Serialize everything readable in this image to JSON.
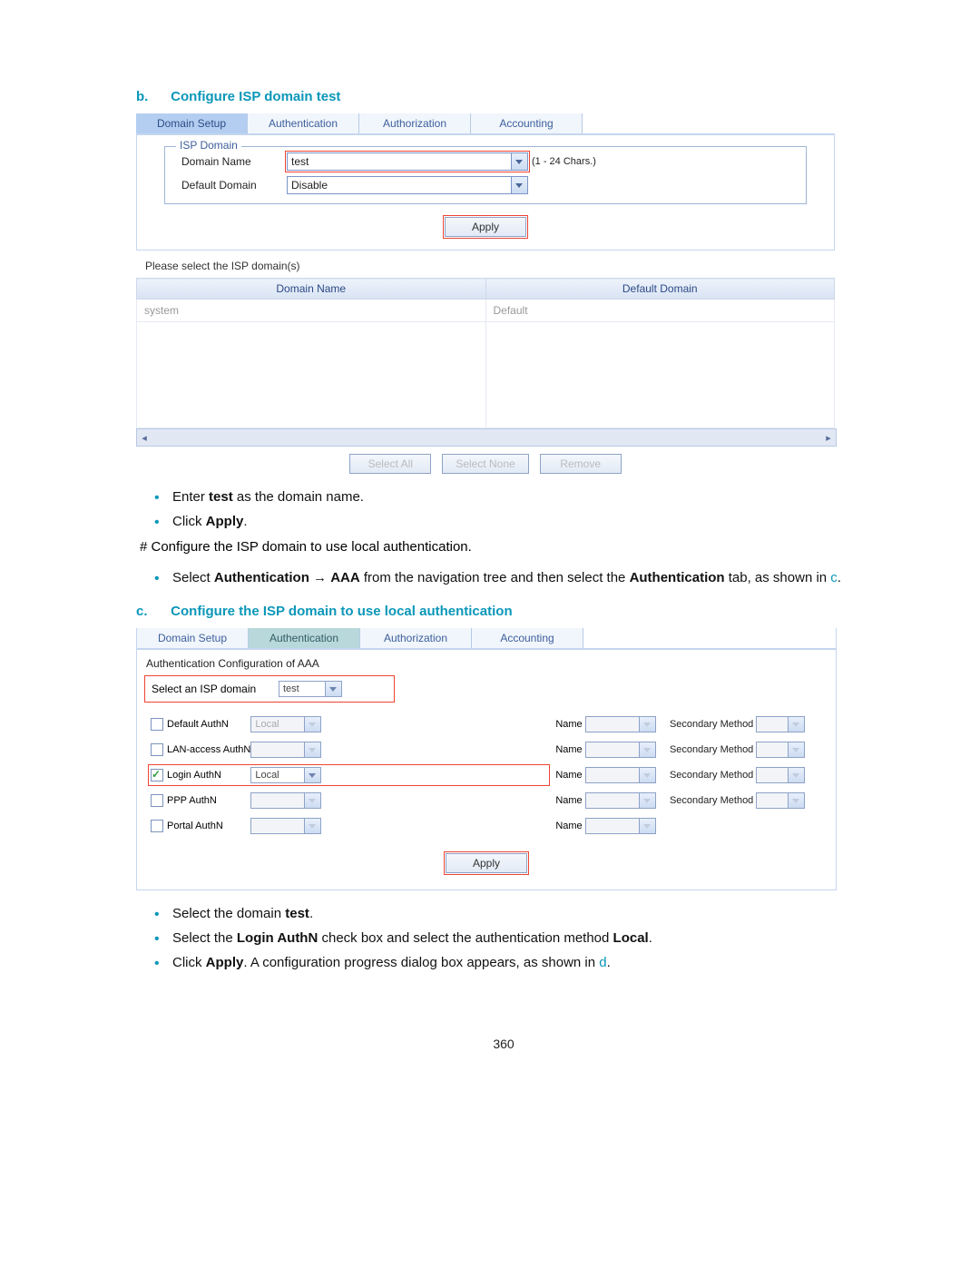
{
  "section_b": {
    "marker": "b.",
    "title": "Configure ISP domain test"
  },
  "panelA": {
    "tabs": [
      "Domain Setup",
      "Authentication",
      "Authorization",
      "Accounting"
    ],
    "active_tab_index": 0,
    "fieldset_legend": "ISP Domain",
    "domain_name_label": "Domain Name",
    "domain_name_value": "test",
    "chars_hint": "(1 - 24 Chars.)",
    "default_domain_label": "Default Domain",
    "default_domain_value": "Disable",
    "apply_label": "Apply",
    "please_select": "Please select the ISP domain(s)",
    "table_headers": [
      "Domain Name",
      "Default Domain"
    ],
    "table_rows": [
      {
        "domain": "system",
        "default": "Default"
      }
    ],
    "buttons": [
      "Select All",
      "Select None",
      "Remove"
    ]
  },
  "instructions1": {
    "items": [
      {
        "pre": "Enter ",
        "bold": "test",
        "post": " as the domain name."
      },
      {
        "pre": "Click ",
        "bold": "Apply",
        "post": "."
      }
    ],
    "hash_line": "# Configure the ISP domain to use local authentication.",
    "nav_line_pre": "Select ",
    "nav_bold1": "Authentication",
    "nav_arrow": " → ",
    "nav_bold2": "AAA",
    "nav_mid": " from the navigation tree and then select the ",
    "nav_bold3": "Authentication",
    "nav_post": " tab, as shown in ",
    "nav_ref": "c",
    "nav_end": "."
  },
  "section_c": {
    "marker": "c.",
    "title": "Configure the ISP domain to use local authentication"
  },
  "panelB": {
    "tabs": [
      "Domain Setup",
      "Authentication",
      "Authorization",
      "Accounting"
    ],
    "active_tab_index": 1,
    "header_text": "Authentication Configuration of AAA",
    "select_isp_label": "Select an ISP domain",
    "select_isp_value": "test",
    "name_label": "Name",
    "secondary_label": "Secondary Method",
    "rows": [
      {
        "checked": false,
        "label": "Default AuthN",
        "method": "Local",
        "method_disabled": true,
        "has_secondary": true,
        "highlight": false
      },
      {
        "checked": false,
        "label": "LAN-access AuthN",
        "method": "",
        "method_disabled": true,
        "has_secondary": true,
        "highlight": false
      },
      {
        "checked": true,
        "label": "Login AuthN",
        "method": "Local",
        "method_disabled": false,
        "has_secondary": true,
        "highlight": true
      },
      {
        "checked": false,
        "label": "PPP AuthN",
        "method": "",
        "method_disabled": true,
        "has_secondary": true,
        "highlight": false
      },
      {
        "checked": false,
        "label": "Portal AuthN",
        "method": "",
        "method_disabled": true,
        "has_secondary": false,
        "highlight": false
      }
    ],
    "apply_label": "Apply"
  },
  "instructions2": {
    "items": [
      {
        "parts": [
          {
            "t": "Select the domain "
          },
          {
            "b": "test"
          },
          {
            "t": "."
          }
        ]
      },
      {
        "parts": [
          {
            "t": "Select the "
          },
          {
            "b": "Login AuthN"
          },
          {
            "t": " check box and select the authentication method "
          },
          {
            "b": "Local"
          },
          {
            "t": "."
          }
        ]
      },
      {
        "parts": [
          {
            "t": "Click "
          },
          {
            "b": "Apply"
          },
          {
            "t": ". A configuration progress dialog box appears, as shown in "
          },
          {
            "r": "d"
          },
          {
            "t": "."
          }
        ]
      }
    ]
  },
  "page_number": "360"
}
